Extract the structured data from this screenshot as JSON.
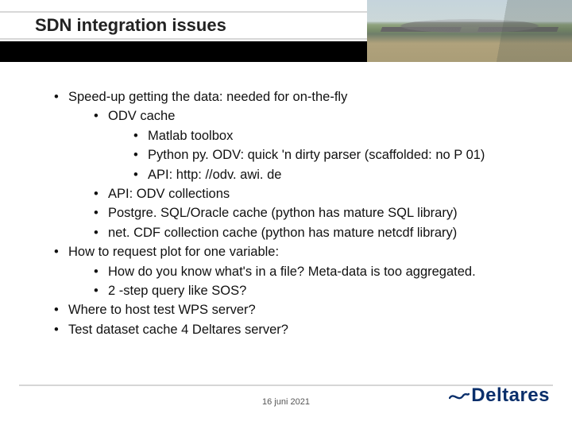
{
  "title": "SDN integration issues",
  "bullets": {
    "b1": "Speed-up getting the data: needed for on-the-fly",
    "b1_1": "ODV cache",
    "b1_1_1": "Matlab toolbox",
    "b1_1_2": "Python py. ODV: quick 'n dirty parser (scaffolded: no P 01)",
    "b1_1_3": "API: http: //odv. awi. de",
    "b1_2": "API: ODV collections",
    "b1_3": "Postgre. SQL/Oracle cache (python has mature SQL library)",
    "b1_4": "net. CDF collection cache (python has mature netcdf library)",
    "b2": "How to request plot for one variable:",
    "b2_1": "How do you know what's in a file? Meta-data is too aggregated.",
    "b2_2": "2 -step query like SOS?",
    "b3": "Where to host test WPS server?",
    "b4": "Test dataset cache 4 Deltares server?"
  },
  "footer_date": "16 juni 2021",
  "logo_text": "Deltares"
}
